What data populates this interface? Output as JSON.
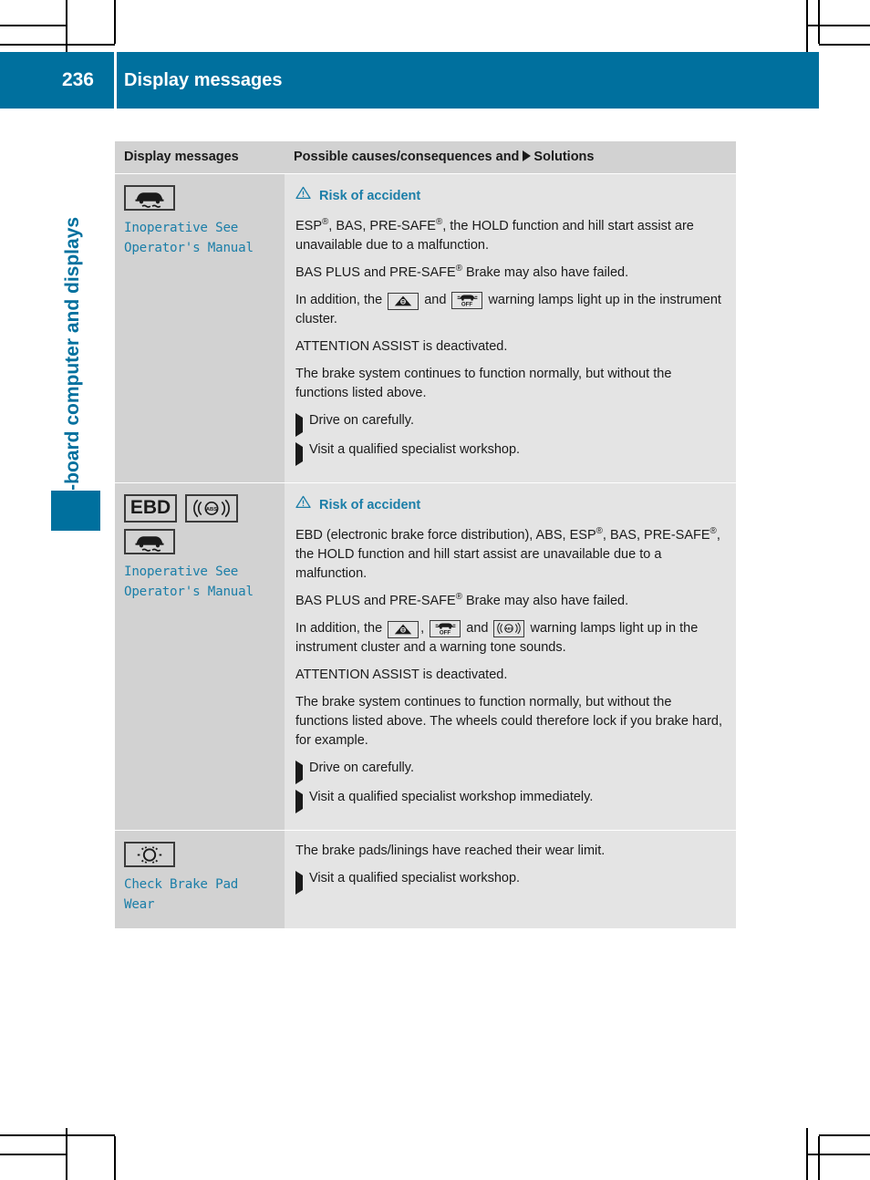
{
  "header": {
    "page_number": "236",
    "title": "Display messages"
  },
  "chapter": {
    "label": "On-board computer and displays"
  },
  "table": {
    "headers": {
      "col1": "Display messages",
      "col2_before": "Possible causes/consequences and",
      "col2_after": "Solutions"
    },
    "rows": [
      {
        "icons": [
          "esp-car-skid-icon"
        ],
        "message": "Inoperative See\nOperator's Manual",
        "message_line1": "Inoperative See",
        "message_line2": "Operator's Manual",
        "warning_heading": "Risk of accident",
        "paragraphs": [
          {
            "segments": [
              {
                "type": "text",
                "value": "ESP"
              },
              {
                "type": "sup",
                "value": "®"
              },
              {
                "type": "text",
                "value": ", BAS, PRE-SAFE"
              },
              {
                "type": "sup",
                "value": "®"
              },
              {
                "type": "text",
                "value": ", the HOLD function and hill start assist are unavailable due to a malfunction."
              }
            ]
          },
          {
            "segments": [
              {
                "type": "text",
                "value": "BAS PLUS and PRE-SAFE"
              },
              {
                "type": "sup",
                "value": "®"
              },
              {
                "type": "text",
                "value": " Brake may also have failed."
              }
            ]
          },
          {
            "segments": [
              {
                "type": "text",
                "value": "In addition, the "
              },
              {
                "type": "icon",
                "value": "warning-triangle-lamp-icon"
              },
              {
                "type": "text",
                "value": " and "
              },
              {
                "type": "icon",
                "value": "brake-off-lamp-icon"
              },
              {
                "type": "text",
                "value": " warning lamps light up in the instrument cluster."
              }
            ]
          },
          {
            "segments": [
              {
                "type": "text",
                "value": "ATTENTION ASSIST is deactivated."
              }
            ]
          },
          {
            "segments": [
              {
                "type": "text",
                "value": "The brake system continues to function normally, but without the functions listed above."
              }
            ]
          }
        ],
        "solutions": [
          "Drive on carefully.",
          "Visit a qualified specialist workshop."
        ]
      },
      {
        "icons": [
          "ebd-text-icon",
          "abs-lamp-icon",
          "esp-car-skid-icon"
        ],
        "message_line1": "Inoperative See",
        "message_line2": "Operator's Manual",
        "warning_heading": "Risk of accident",
        "paragraphs": [
          {
            "segments": [
              {
                "type": "text",
                "value": "EBD (electronic brake force distribution), ABS, ESP"
              },
              {
                "type": "sup",
                "value": "®"
              },
              {
                "type": "text",
                "value": ", BAS, PRE-SAFE"
              },
              {
                "type": "sup",
                "value": "®"
              },
              {
                "type": "text",
                "value": ", the HOLD function and hill start assist are unavailable due to a malfunction."
              }
            ]
          },
          {
            "segments": [
              {
                "type": "text",
                "value": "BAS PLUS and PRE-SAFE"
              },
              {
                "type": "sup",
                "value": "®"
              },
              {
                "type": "text",
                "value": " Brake may also have failed."
              }
            ]
          },
          {
            "segments": [
              {
                "type": "text",
                "value": "In addition, the "
              },
              {
                "type": "icon",
                "value": "warning-triangle-lamp-icon"
              },
              {
                "type": "text",
                "value": ", "
              },
              {
                "type": "icon",
                "value": "brake-off-lamp-icon"
              },
              {
                "type": "text",
                "value": " and "
              },
              {
                "type": "icon",
                "value": "abs-lamp-icon"
              },
              {
                "type": "text",
                "value": " warning lamps light up in the instrument cluster and a warning tone sounds."
              }
            ]
          },
          {
            "segments": [
              {
                "type": "text",
                "value": "ATTENTION ASSIST is deactivated."
              }
            ]
          },
          {
            "segments": [
              {
                "type": "text",
                "value": "The brake system continues to function normally, but without the functions listed above. The wheels could therefore lock if you brake hard, for example."
              }
            ]
          }
        ],
        "solutions": [
          "Drive on carefully.",
          "Visit a qualified specialist workshop immediately."
        ]
      },
      {
        "icons": [
          "brake-pad-wear-icon"
        ],
        "message_line1": "Check Brake Pad",
        "message_line2": "Wear",
        "warning_heading": null,
        "paragraphs": [
          {
            "segments": [
              {
                "type": "text",
                "value": "The brake pads/linings have reached their wear limit."
              }
            ]
          }
        ],
        "solutions": [
          "Visit a qualified specialist workshop."
        ]
      }
    ]
  },
  "colors": {
    "brand_blue": "#00709e",
    "message_blue": "#1b7ea8",
    "header_cell": "#d2d2d2",
    "body_cell": "#e4e4e4"
  }
}
